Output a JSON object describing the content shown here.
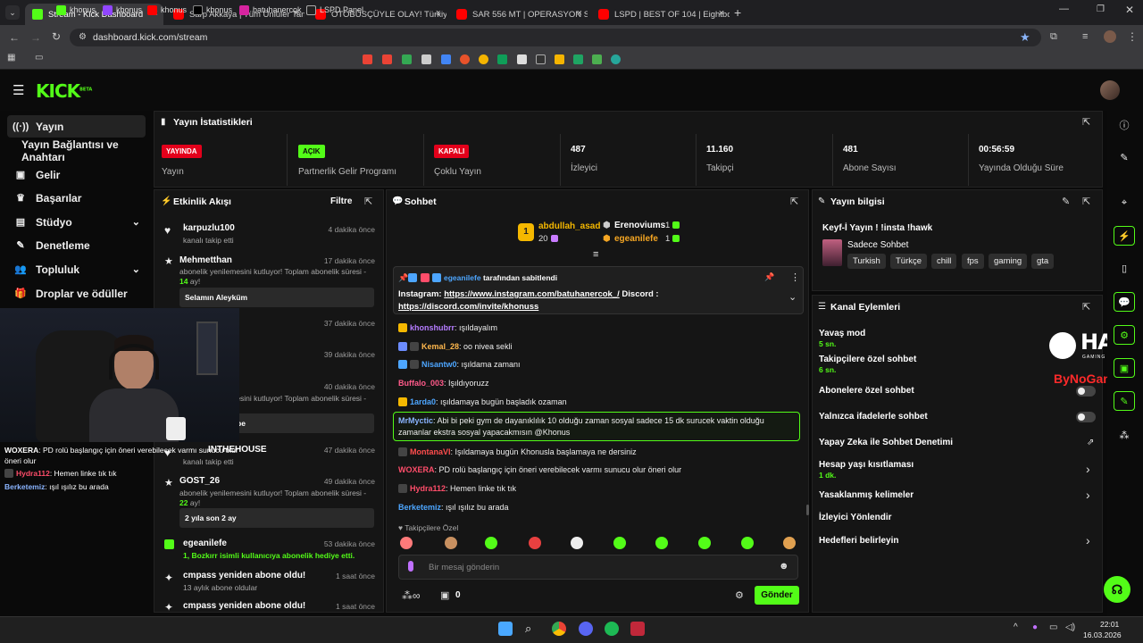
{
  "browser": {
    "tabs": [
      {
        "title": "Stream - Kick Dashboard",
        "icon": "kick-icon",
        "active": true
      },
      {
        "title": "Sarp Akkaya | Tüm Ünlüler Tanı",
        "icon": "youtube-icon"
      },
      {
        "title": "OTOBÜSÇÜYLE OLAY! Türkiye'd",
        "icon": "youtube-icon"
      },
      {
        "title": "SAR 556 MT | OPERASYON SAH",
        "icon": "youtube-icon"
      },
      {
        "title": "LSPD | BEST OF 104 | Eightborn",
        "icon": "youtube-icon"
      }
    ],
    "url": "dashboard.kick.com/stream",
    "bookmarks": [
      "khonus",
      "khonus",
      "khonus",
      "khonus",
      "batuhanercok",
      "LSPD Panel"
    ]
  },
  "app": {
    "logo": "KICK",
    "logo_sup": "BETA"
  },
  "sidebar": {
    "items": [
      {
        "label": "Yayın",
        "icon": "broadcast-icon",
        "active": true
      },
      {
        "label": "Yayın Bağlantısı ve Anahtarı",
        "icon": ""
      },
      {
        "label": "Gelir",
        "icon": "money-icon"
      },
      {
        "label": "Başarılar",
        "icon": "trophy-icon"
      },
      {
        "label": "Stüdyo",
        "icon": "studio-icon",
        "expand": true
      },
      {
        "label": "Denetleme",
        "icon": "wrench-icon"
      },
      {
        "label": "Topluluk",
        "icon": "community-icon",
        "expand": true
      },
      {
        "label": "Droplar ve ödüller",
        "icon": "gift-icon"
      }
    ]
  },
  "stats": {
    "title": "Yayın İstatistikleri",
    "items": [
      {
        "badge": "YAYINDA",
        "label": "Yayın",
        "color": "#e3001b"
      },
      {
        "badge": "AÇIK",
        "label": "Partnerlik Gelir Programı",
        "color": "#53fc18"
      },
      {
        "badge": "KAPALI",
        "label": "Çoklu Yayın",
        "color": "#e3001b"
      },
      {
        "value": "487",
        "label": "İzleyici"
      },
      {
        "value": "11.160",
        "label": "Takipçi"
      },
      {
        "value": "481",
        "label": "Abone Sayısı"
      },
      {
        "value": "00:56:59",
        "label": "Yayında Olduğu Süre"
      }
    ]
  },
  "activity": {
    "title": "Etkinlik Akışı",
    "filter": "Filtre",
    "events": [
      {
        "name": "karpuzlu100",
        "sub": "kanalı takip etti",
        "time": "4 dakika önce"
      },
      {
        "name": "Mehmetthan",
        "sub": "abonelik yenilemesini kutluyor! Toplam abonelik süresi -",
        "sub2": "14",
        "sub3": "ay!",
        "box": "Selamın Aleyküm",
        "time": "17 dakika önce"
      },
      {
        "time": "37 dakika önce"
      },
      {
        "time": "39 dakika önce"
      },
      {
        "sub": "abonelik yenilemesini kutluyor! Toplam abonelik süresi -",
        "box": "be",
        "time": "40 dakika önce"
      },
      {
        "name": "INTHEHOUSE",
        "sub": "kanalı takip etti",
        "time": "47 dakika önce"
      },
      {
        "name": "GOST_26",
        "sub": "abonelik yenilemesini kutluyor! Toplam abonelik süresi -",
        "sub2": "22",
        "sub3": "ay!",
        "box": "2 yıla son 2 ay",
        "time": "49 dakika önce"
      },
      {
        "name": "egeanilefe",
        "sub": "1, Bozkırr isimli kullanıcıya abonelik hediye etti.",
        "time": "53 dakika önce"
      },
      {
        "name": "cmpass yeniden abone oldu!",
        "sub": "13 aylık abone oldular",
        "time": "1 saat önce"
      },
      {
        "name": "cmpass yeniden abone oldu!",
        "time": "1 saat önce"
      }
    ]
  },
  "chat": {
    "title": "Sohbet",
    "leaders": [
      {
        "rank": "1",
        "name": "abdullah_asad",
        "count": "20"
      },
      {
        "name": "Erenoviums",
        "count": "1"
      },
      {
        "name": "egeanilefe",
        "count": "1"
      }
    ],
    "pinned_by": "egeanilefe",
    "pinned_by_suffix": "tarafından sabitlendi",
    "pinned_prefix": "Instagram: ",
    "pinned_link1": "https://www.instagram.com/batuhanercok_/",
    "pinned_mid": " Discord :",
    "pinned_link2": "https://discord.com/invite/khonuss",
    "messages": [
      {
        "user": "khonshubrr",
        "color": "#b57cff",
        "text": ": ışıldayalım"
      },
      {
        "user": "Kemal_28",
        "color": "#ffb84d",
        "text": ": oo nivea sekli"
      },
      {
        "user": "Nisantw0",
        "color": "#4da6ff",
        "text": ": ışıldama zamanı"
      },
      {
        "user": "Buffalo_003",
        "color": "#ff5a8a",
        "text": ": Işıldıyoruzz"
      },
      {
        "user": "1arda0",
        "color": "#4da6ff",
        "text": ": ışıldamaya bugün başladık ozaman"
      },
      {
        "user": "MrMyctic",
        "color": "#8ab4ff",
        "text": ": Abi bi peki gym de dayanıklılık 10 olduğu zaman sosyal sadece 15 dk surucek vaktin olduğu",
        "text2": "zamanlar ekstra sosyal yapacakmısın @Khonus",
        "highlight": true
      },
      {
        "user": "MontanaVI",
        "color": "#ff4d4d",
        "text": ": Işıldamaya bugün Khonusla başlamaya ne dersiniz"
      },
      {
        "user": "WOXERA",
        "color": "#ff4d6a",
        "text": ": PD rolü başlangıç için öneri verebilecek varmı sunucu olur öneri olur"
      },
      {
        "user": "Hydra112",
        "color": "#ff4d6a",
        "text": ": Hemen linke tık tık"
      },
      {
        "user": "Berketemiz",
        "color": "#4da6ff",
        "text": ": ışıl ışılız bu arada"
      }
    ],
    "followers_only": "Takipçilere Özel",
    "input_placeholder": "Bir mesaj gönderin",
    "points": "0",
    "send_label": "Gönder"
  },
  "stream_info": {
    "title": "Yayın bilgisi",
    "stream_title": "Keyf-İ Yayın ! !insta !hawk",
    "category": "Sadece Sohbet",
    "tags": [
      "Turkish",
      "Türkçe",
      "chill",
      "fps",
      "gaming",
      "gta"
    ]
  },
  "channel_actions": {
    "title": "Kanal Eylemleri",
    "items": [
      {
        "label": "Yavaş mod",
        "sub": "5 sn."
      },
      {
        "label": "Takipçilere özel sohbet",
        "sub": "6 sn."
      },
      {
        "label": "Abonelere özel sohbet",
        "control": "toggle"
      },
      {
        "label": "Yalnızca ifadelerle sohbet",
        "control": "toggle"
      },
      {
        "label": "Yapay Zeka ile Sohbet Denetimi",
        "control": "external"
      },
      {
        "label": "Hesap yaşı kısıtlaması",
        "sub": "1 dk.",
        "control": "chevron"
      },
      {
        "label": "Yasaklanmış kelimeler",
        "control": "chevron"
      },
      {
        "label": "İzleyici Yönlendir"
      },
      {
        "label": "Hedefleri belirleyin",
        "control": "chevron"
      }
    ]
  },
  "overlay": {
    "chat": [
      {
        "user": "WOXERA",
        "text": ": PD rolü başlangıç için öneri verebilecek varmı sunucu olur öneri olur"
      },
      {
        "user": "Hydra112",
        "text": ": Hemen linke tık tık"
      },
      {
        "user": "Berketemiz",
        "text": ": ışıl ışılız bu arada"
      }
    ],
    "hawk": "HAWK",
    "hawk_sub": "GAMING CHAIR",
    "bynogame": "ByNoGame"
  },
  "taskbar": {
    "time": "22:01",
    "date": "16.03.2026"
  }
}
